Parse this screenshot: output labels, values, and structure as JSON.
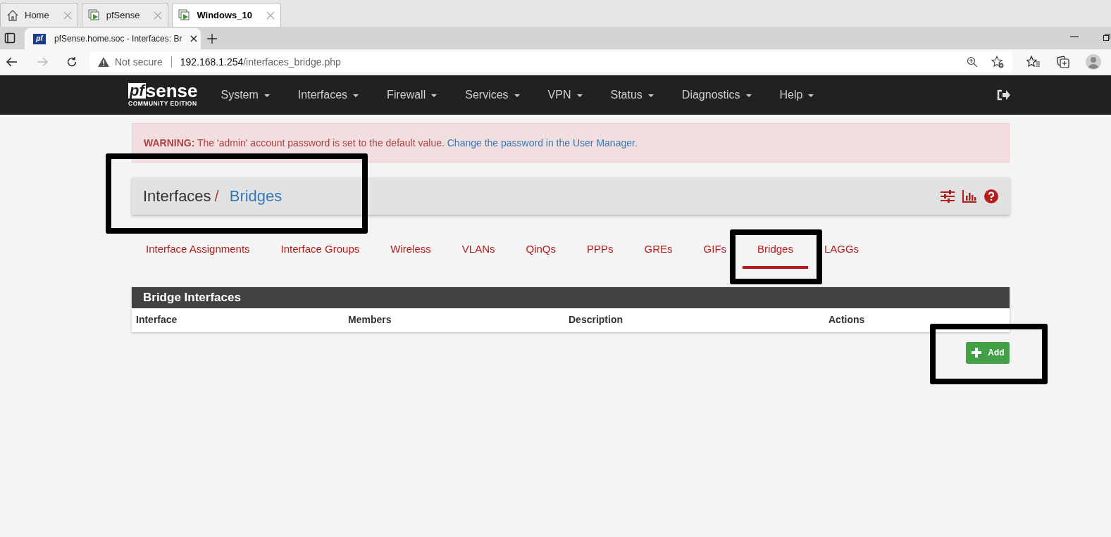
{
  "vm_tabs": [
    {
      "label": "Home",
      "kind": "home",
      "selected": false
    },
    {
      "label": "pfSense",
      "kind": "vm",
      "selected": false
    },
    {
      "label": "Windows_10",
      "kind": "vm",
      "selected": true
    }
  ],
  "browser": {
    "favicon_text": "pf",
    "tab_title": "pfSense.home.soc - Interfaces: Br",
    "security": "Not secure",
    "url_host": "192.168.1.254",
    "url_path": "/interfaces_bridge.php"
  },
  "navbar": {
    "logo": "sense",
    "logo_mark": "pf",
    "logo_sub": "COMMUNITY EDITION",
    "menu": [
      "System",
      "Interfaces",
      "Firewall",
      "Services",
      "VPN",
      "Status",
      "Diagnostics",
      "Help"
    ]
  },
  "warning": {
    "label": "WARNING:",
    "text": "The 'admin' account password is set to the default value.",
    "link": "Change the password in the User Manager."
  },
  "breadcrumb": {
    "parent": "Interfaces",
    "separator": "/",
    "current": "Bridges"
  },
  "tabs": [
    {
      "label": "Interface Assignments",
      "selected": false
    },
    {
      "label": "Interface Groups",
      "selected": false
    },
    {
      "label": "Wireless",
      "selected": false
    },
    {
      "label": "VLANs",
      "selected": false
    },
    {
      "label": "QinQs",
      "selected": false
    },
    {
      "label": "PPPs",
      "selected": false
    },
    {
      "label": "GREs",
      "selected": false
    },
    {
      "label": "GIFs",
      "selected": false
    },
    {
      "label": "Bridges",
      "selected": true
    },
    {
      "label": "LAGGs",
      "selected": false
    }
  ],
  "table": {
    "title": "Bridge Interfaces",
    "columns": [
      "Interface",
      "Members",
      "Description",
      "Actions"
    ]
  },
  "add_button": "Add"
}
